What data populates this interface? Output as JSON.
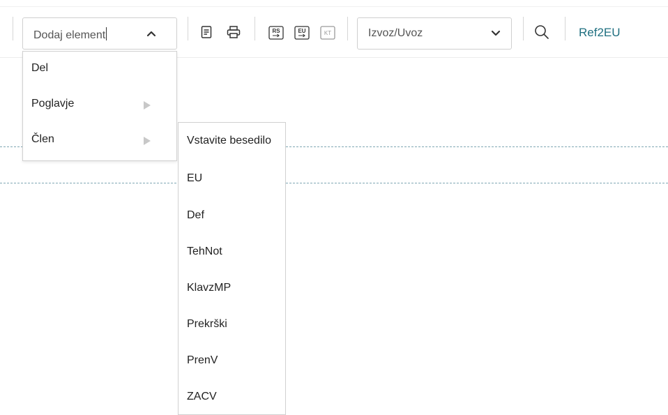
{
  "toolbar": {
    "element_dropdown": {
      "value": "Dodaj element",
      "icon": "chevron-up-icon"
    },
    "icons": [
      "document-icon",
      "print-icon",
      "rs-export-icon",
      "eu-export-icon",
      "kt-icon"
    ],
    "rs_label": "RS",
    "eu_label": "EU",
    "kt_label": "KT",
    "export_dropdown": {
      "value": "Izvoz/Uvoz",
      "icon": "chevron-down-icon"
    },
    "search_icon": "search-icon",
    "ref_link": "Ref2EU",
    "link_color": "#1f6f80"
  },
  "element_menu": {
    "items": [
      {
        "label": "Del",
        "has_submenu": false
      },
      {
        "label": "Poglavje",
        "has_submenu": true
      },
      {
        "label": "Člen",
        "has_submenu": true
      }
    ]
  },
  "submenu": {
    "items": [
      "Vstavite besedilo",
      "EU",
      "Def",
      "TehNot",
      "KlavzMP",
      "Prekrški",
      "PrenV",
      "ZACV"
    ]
  }
}
